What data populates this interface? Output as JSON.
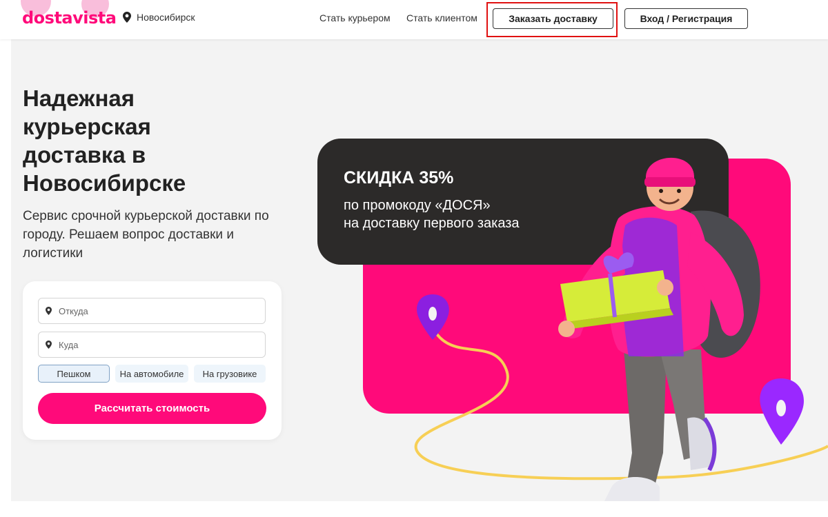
{
  "header": {
    "logo": "dostavista",
    "city": "Новосибирск",
    "nav_courier": "Стать курьером",
    "nav_client": "Стать клиентом",
    "order_button": "Заказать доставку",
    "login_button": "Вход / Регистрация"
  },
  "hero": {
    "title": "Надежная курьерская доставка в Новосибирске",
    "subtitle": "Сервис срочной курьерской доставки по городу. Решаем вопрос доставки и логистики"
  },
  "form": {
    "from_placeholder": "Откуда",
    "to_placeholder": "Куда",
    "modes": [
      "Пешком",
      "На автомобиле",
      "На грузовике"
    ],
    "active_mode": "Пешком",
    "calc_button": "Рассчитать стоимость"
  },
  "promo": {
    "title": "СКИДКА 35%",
    "line1": "по промокоду «ДОСЯ»",
    "line2": "на доставку первого заказа"
  },
  "colors": {
    "brand_pink": "#ff0a7a",
    "dark_card": "#2c2a29",
    "highlight_red": "#e01010"
  }
}
